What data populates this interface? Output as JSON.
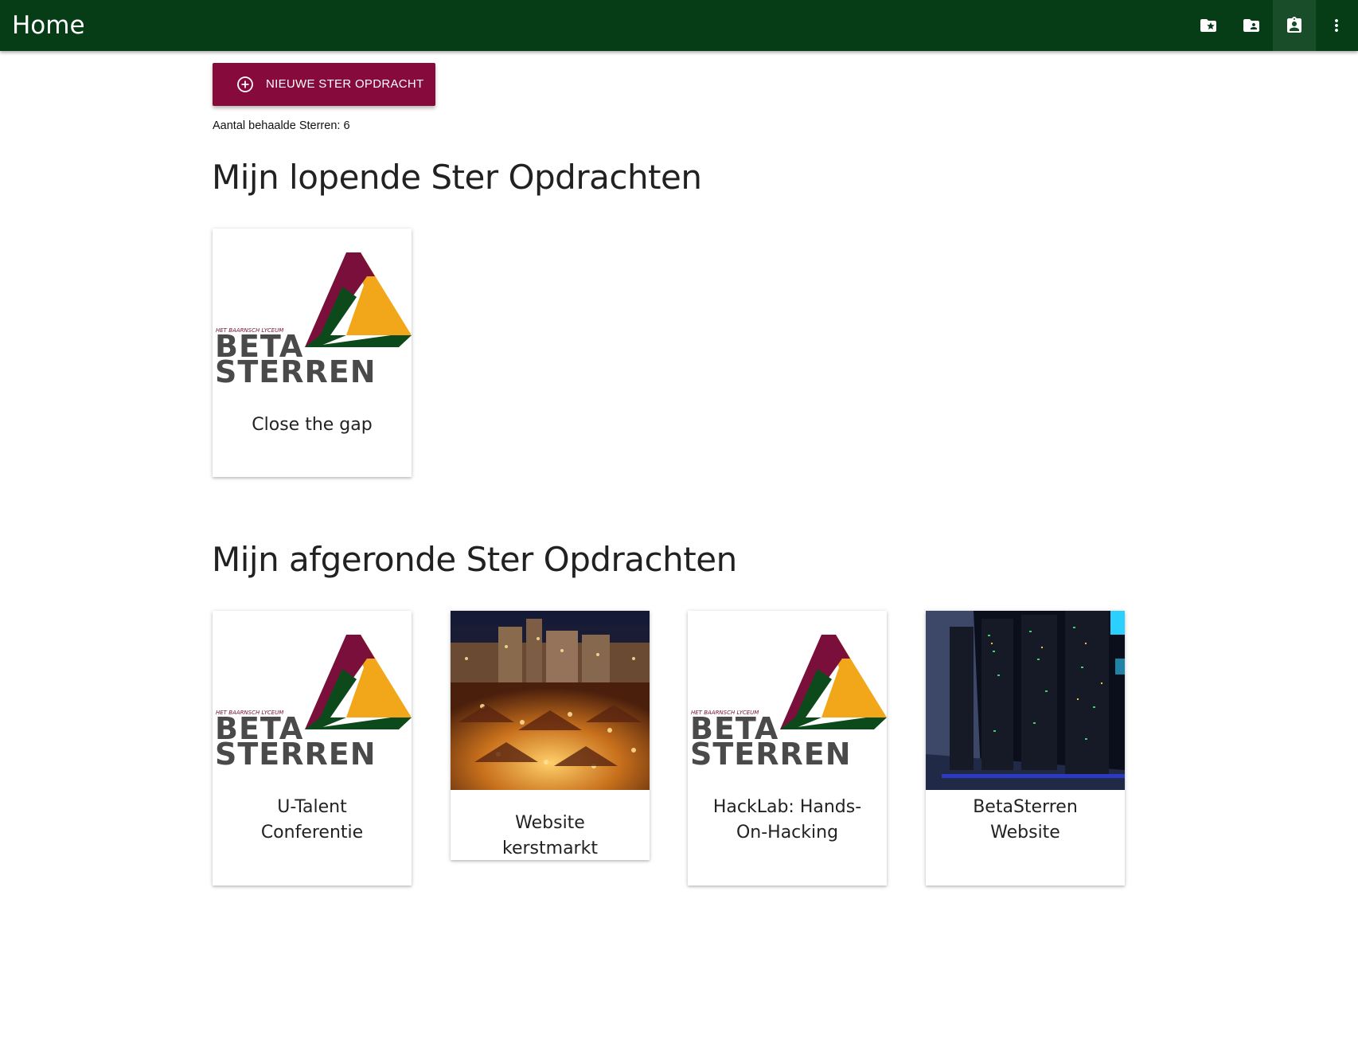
{
  "header": {
    "title": "Home",
    "actions": [
      {
        "icon": "folder-star-icon"
      },
      {
        "icon": "folder-account-icon"
      },
      {
        "icon": "assignment-ind-icon"
      },
      {
        "icon": "more-vert-icon"
      }
    ]
  },
  "main": {
    "new_button_label": "NIEUWE STER OPDRACHT",
    "star_count_label": "Aantal behaalde Sterren: 6",
    "running": {
      "title": "Mijn lopende Ster Opdrachten",
      "cards": [
        {
          "title": "Close the gap",
          "image": "betasterren-logo"
        }
      ]
    },
    "completed": {
      "title": "Mijn afgeronde Ster Opdrachten",
      "cards": [
        {
          "title": "U-Talent Conferentie",
          "image": "betasterren-logo"
        },
        {
          "title": "Website kerstmarkt",
          "image": "christmas-market-photo"
        },
        {
          "title": "HackLab: Hands-On-Hacking",
          "image": "betasterren-logo"
        },
        {
          "title": "BetaSterren Website",
          "image": "server-room-photo"
        }
      ]
    }
  },
  "logo": {
    "school_text": "HET BAARNSCH LYCEUM",
    "line1": "BETA",
    "line2": "STERREN"
  },
  "colors": {
    "header": "#063d16",
    "button": "#860a3c",
    "logo_maroon": "#7a0f3b",
    "logo_green": "#0c4a1c",
    "logo_orange": "#f2a71b",
    "logo_text": "#4a4a4a"
  }
}
